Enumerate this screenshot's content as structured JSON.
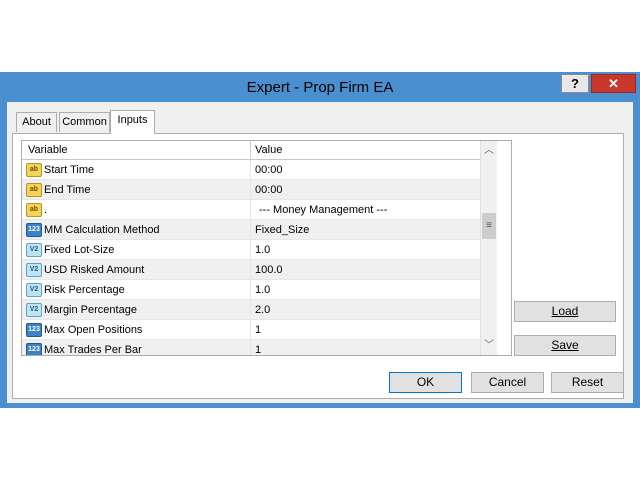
{
  "window": {
    "title": "Expert - Prop Firm EA",
    "help_label": "?",
    "close_label": "x"
  },
  "tabs": [
    {
      "label": "About"
    },
    {
      "label": "Common"
    },
    {
      "label": "Inputs"
    }
  ],
  "grid": {
    "columns": [
      "Variable",
      "Value"
    ],
    "rows": [
      {
        "icon": "ab",
        "name": "Start Time",
        "value": "00:00"
      },
      {
        "icon": "ab",
        "name": "End Time",
        "value": "00:00"
      },
      {
        "icon": "ab",
        "name": ".",
        "value": "--- Money Management ---"
      },
      {
        "icon": "123",
        "name": "MM Calculation Method",
        "value": "Fixed_Size"
      },
      {
        "icon": "v2",
        "name": "Fixed Lot-Size",
        "value": "1.0"
      },
      {
        "icon": "v2",
        "name": "USD Risked Amount",
        "value": "100.0"
      },
      {
        "icon": "v2",
        "name": "Risk Percentage",
        "value": "1.0"
      },
      {
        "icon": "v2",
        "name": "Margin Percentage",
        "value": "2.0"
      },
      {
        "icon": "123",
        "name": "Max Open Positions",
        "value": "1"
      },
      {
        "icon": "123",
        "name": "Max Trades Per Bar",
        "value": "1"
      }
    ]
  },
  "side_buttons": {
    "load_label": "Load",
    "save_label": "Save"
  },
  "footer_buttons": {
    "ok_label": "OK",
    "cancel_label": "Cancel",
    "reset_label": "Reset"
  },
  "colors": {
    "titlebar": "#4a8fd0",
    "close_button": "#c7372d",
    "string_icon": "#f3d35a",
    "integer_icon": "#3e82c8",
    "double_icon": "#bfe3f3"
  }
}
